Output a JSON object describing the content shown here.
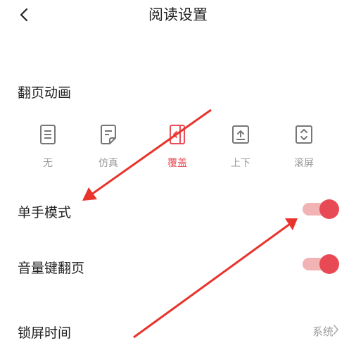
{
  "header": {
    "title": "阅读设置"
  },
  "page_turn": {
    "label": "翻页动画",
    "options": [
      {
        "label": "无",
        "icon": "document-lines-icon",
        "selected": false
      },
      {
        "label": "仿真",
        "icon": "page-curl-icon",
        "selected": false
      },
      {
        "label": "覆盖",
        "icon": "cover-page-icon",
        "selected": true
      },
      {
        "label": "上下",
        "icon": "scroll-up-icon",
        "selected": false
      },
      {
        "label": "滚屏",
        "icon": "scroll-updown-icon",
        "selected": false
      }
    ]
  },
  "one_hand": {
    "label": "单手模式",
    "enabled": true
  },
  "volume_key": {
    "label": "音量键翻页",
    "enabled": true
  },
  "lock_screen": {
    "label": "锁屏时间",
    "value": "系统"
  },
  "colors": {
    "accent": "#e84a55",
    "toggle_track": "#f2b3b5",
    "muted": "#999999",
    "arrow": "#e8342c"
  }
}
